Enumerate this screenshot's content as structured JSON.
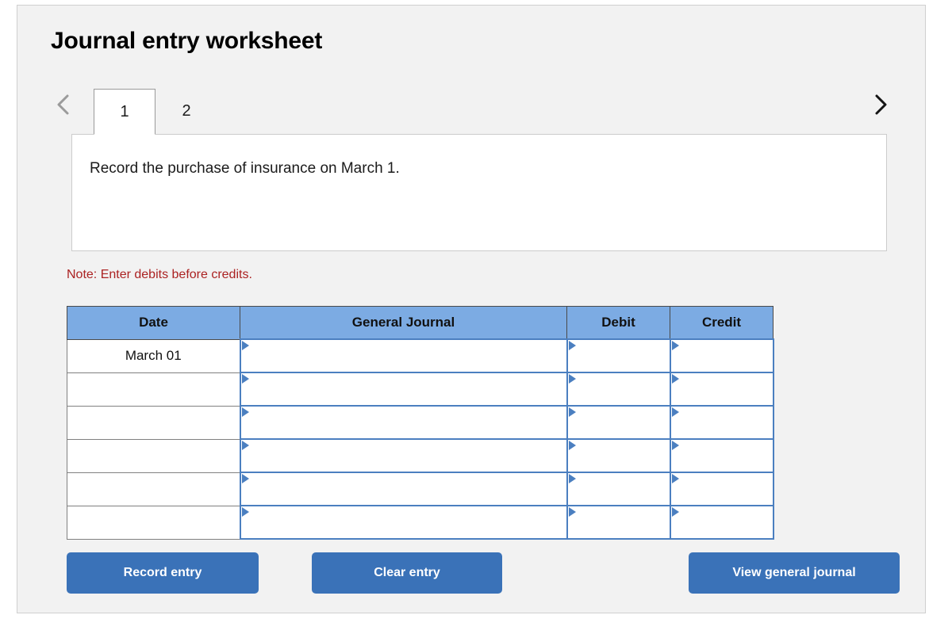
{
  "page": {
    "title": "Journal entry worksheet"
  },
  "nav": {
    "prev_icon": "chevron-left-icon",
    "next_icon": "chevron-right-icon"
  },
  "tabs": [
    {
      "label": "1",
      "active": true
    },
    {
      "label": "2",
      "active": false
    }
  ],
  "prompt": {
    "text": "Record the purchase of insurance on March 1."
  },
  "note": {
    "text": "Note: Enter debits before credits."
  },
  "table": {
    "headers": {
      "date": "Date",
      "general_journal": "General Journal",
      "debit": "Debit",
      "credit": "Credit"
    },
    "rows": [
      {
        "date": "March 01",
        "general_journal": "",
        "debit": "",
        "credit": ""
      },
      {
        "date": "",
        "general_journal": "",
        "debit": "",
        "credit": ""
      },
      {
        "date": "",
        "general_journal": "",
        "debit": "",
        "credit": ""
      },
      {
        "date": "",
        "general_journal": "",
        "debit": "",
        "credit": ""
      },
      {
        "date": "",
        "general_journal": "",
        "debit": "",
        "credit": ""
      },
      {
        "date": "",
        "general_journal": "",
        "debit": "",
        "credit": ""
      }
    ]
  },
  "buttons": {
    "record": "Record entry",
    "clear": "Clear entry",
    "view": "View general journal"
  },
  "colors": {
    "header_blue": "#7cabe3",
    "button_blue": "#3a72b8",
    "note_red": "#ab2222",
    "input_border_blue": "#4b7fc0",
    "card_background": "#f2f2f2"
  }
}
